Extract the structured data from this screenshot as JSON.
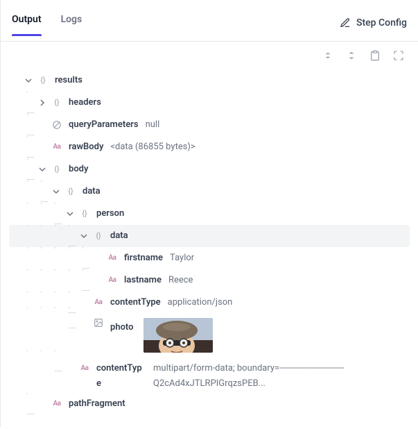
{
  "tabs": {
    "output": "Output",
    "logs": "Logs"
  },
  "config_button": "Step Config",
  "tree": {
    "results": {
      "key": "results",
      "headers": {
        "key": "headers"
      },
      "queryParameters": {
        "key": "queryParameters",
        "value": "null"
      },
      "rawBody": {
        "key": "rawBody",
        "value": "<data (86855 bytes)>"
      },
      "body": {
        "key": "body",
        "data": {
          "key": "data",
          "person": {
            "key": "person",
            "data": {
              "key": "data",
              "firstname": {
                "key": "firstname",
                "value": "Taylor"
              },
              "lastname": {
                "key": "lastname",
                "value": "Reece"
              }
            },
            "contentType": {
              "key": "contentType",
              "value": "application/json"
            },
            "photo": {
              "key": "photo"
            }
          },
          "contentType": {
            "key": "contentType",
            "value": "multipart/form-data; boundary=--------------------------Q2cAd4xJTLRPIGrqzsPEB..."
          }
        }
      },
      "pathFragment": {
        "key": "pathFragment"
      }
    }
  }
}
